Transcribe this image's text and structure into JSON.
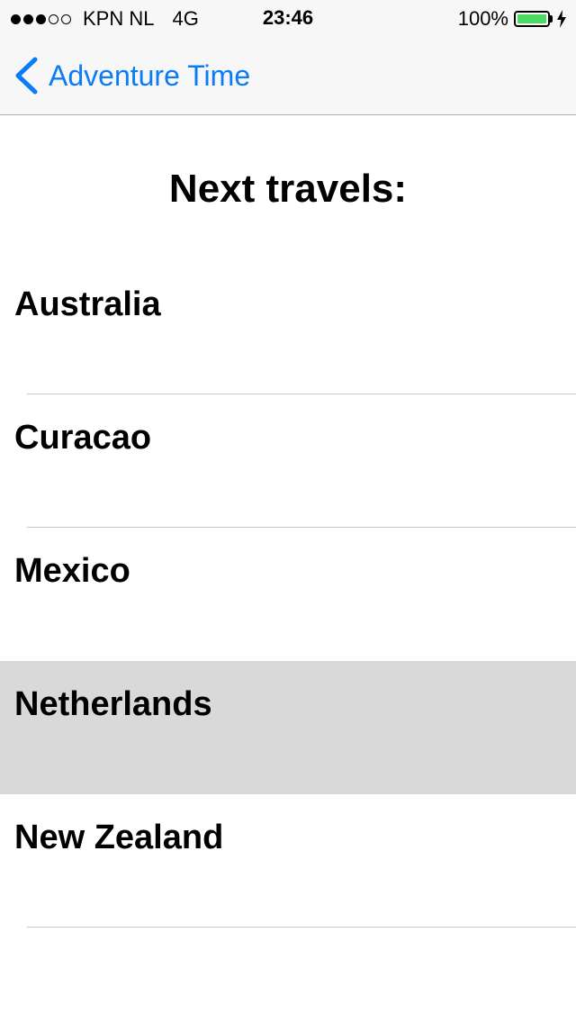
{
  "status_bar": {
    "signal_filled": 3,
    "signal_total": 5,
    "carrier": "KPN NL",
    "network": "4G",
    "time": "23:46",
    "battery_percent": "100%",
    "battery_level": 1.0,
    "battery_color": "#4cd964",
    "charging": true
  },
  "nav_bar": {
    "back_label": "Adventure Time",
    "accent_color": "#0a7cf5",
    "back_icon": "chevron-left-icon"
  },
  "page": {
    "title": "Next travels:"
  },
  "list": {
    "items": [
      {
        "label": "Australia",
        "selected": false
      },
      {
        "label": "Curacao",
        "selected": false
      },
      {
        "label": "Mexico",
        "selected": false
      },
      {
        "label": "Netherlands",
        "selected": true
      },
      {
        "label": "New Zealand",
        "selected": false
      }
    ]
  }
}
